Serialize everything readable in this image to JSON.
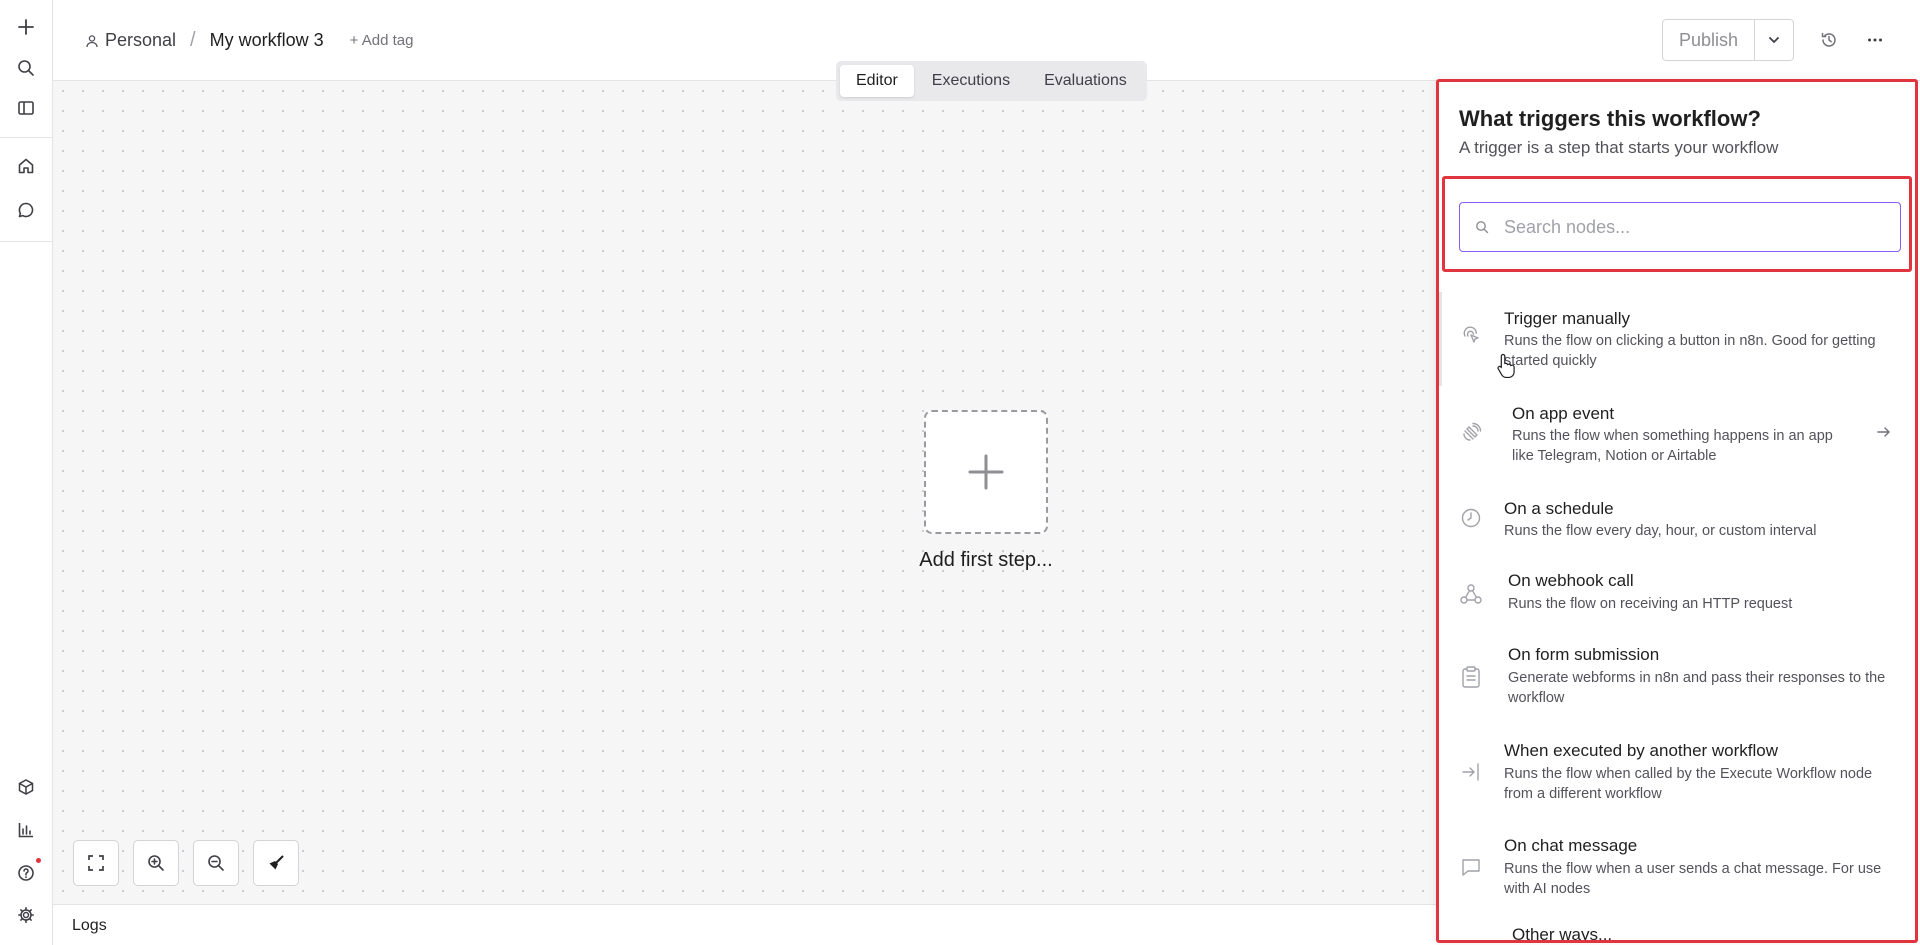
{
  "rail": {
    "items": [
      {
        "icon": "plus-icon"
      },
      {
        "icon": "search-icon"
      },
      {
        "icon": "sidebar-toggle-icon"
      },
      {
        "icon": "home-icon"
      },
      {
        "icon": "chat-icon"
      },
      {
        "icon": "templates-icon"
      },
      {
        "icon": "insights-icon"
      },
      {
        "icon": "help-icon"
      },
      {
        "icon": "settings-icon"
      }
    ]
  },
  "header": {
    "project": "Personal",
    "separator": "/",
    "workflow_name": "My workflow 3",
    "add_tag": "+ Add tag",
    "publish_label": "Publish"
  },
  "tabs": [
    {
      "label": "Editor",
      "active": true
    },
    {
      "label": "Executions",
      "active": false
    },
    {
      "label": "Evaluations",
      "active": false
    }
  ],
  "canvas": {
    "add_first_step": "Add first step..."
  },
  "logs": {
    "label": "Logs"
  },
  "panel": {
    "title": "What triggers this workflow?",
    "subtitle": "A trigger is a step that starts your workflow",
    "search_placeholder": "Search nodes...",
    "items": [
      {
        "name": "Trigger manually",
        "desc": "Runs the flow on clicking a button in n8n. Good for getting started quickly",
        "icon": "cursor-click-icon"
      },
      {
        "name": "On app event",
        "desc": "Runs the flow when something happens in an app like Telegram, Notion or Airtable",
        "icon": "satellite-icon"
      },
      {
        "name": "On a schedule",
        "desc": "Runs the flow every day, hour, or custom interval",
        "icon": "clock-icon"
      },
      {
        "name": "On webhook call",
        "desc": "Runs the flow on receiving an HTTP request",
        "icon": "webhook-icon"
      },
      {
        "name": "On form submission",
        "desc": "Generate webforms in n8n and pass their responses to the workflow",
        "icon": "clipboard-icon"
      },
      {
        "name": "When executed by another workflow",
        "desc": "Runs the flow when called by the Execute Workflow node from a different workflow",
        "icon": "sign-in-icon"
      },
      {
        "name": "On chat message",
        "desc": "Runs the flow when a user sends a chat message. For use with AI nodes",
        "icon": "chat-bubble-icon"
      },
      {
        "name": "Other ways...",
        "desc": "",
        "icon": ""
      }
    ]
  },
  "colors": {
    "highlight_border": "#e0353e",
    "search_focus": "#8b5cf6",
    "canvas_bg": "#f6f6f7"
  }
}
